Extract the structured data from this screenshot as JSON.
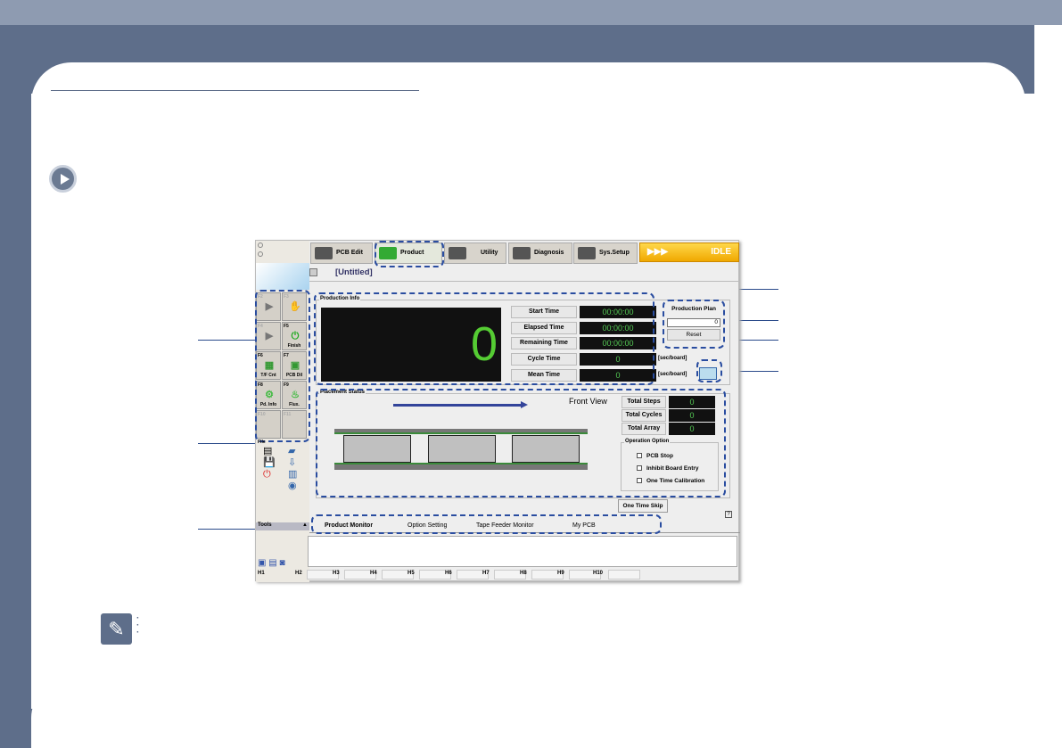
{
  "app": {
    "tabs": [
      {
        "label": "PCB Edit"
      },
      {
        "label": "Product"
      },
      {
        "label": "Utility"
      },
      {
        "label": "Diagnosis"
      },
      {
        "label": "Sys.Setup"
      }
    ],
    "status": {
      "arrows": "▶▶▶",
      "label": "IDLE"
    },
    "file_title": "[Untitled]",
    "sidebar": {
      "fkeys": [
        {
          "key": "F2",
          "label": ""
        },
        {
          "key": "F3",
          "label": ""
        },
        {
          "key": "F4",
          "label": ""
        },
        {
          "key": "F5",
          "label": "Finish"
        },
        {
          "key": "F6",
          "label": "T/F Cnt"
        },
        {
          "key": "F7",
          "label": "PCB Dil"
        },
        {
          "key": "F8",
          "label": "Pd. Info"
        },
        {
          "key": "F9",
          "label": "Flux."
        },
        {
          "key": "F10",
          "label": ""
        },
        {
          "key": "F11",
          "label": ""
        }
      ],
      "file_label": "File",
      "tools_label": "Tools"
    },
    "production_info": {
      "title": "Production Info",
      "big_count": "0",
      "rows": [
        {
          "label": "Start Time",
          "value": "00:00:00"
        },
        {
          "label": "Elapsed Time",
          "value": "00:00:00"
        },
        {
          "label": "Remaining Time",
          "value": "00:00:00"
        },
        {
          "label": "Cycle Time",
          "value": "0"
        },
        {
          "label": "Mean Time",
          "value": "0"
        }
      ],
      "plan_label": "Production Plan",
      "plan_value": "0",
      "reset_label": "Reset",
      "unit1": "[sec/board]",
      "unit2": "[sec/board]"
    },
    "placement": {
      "title": "Placement Status",
      "view": "Front View",
      "stats": [
        {
          "label": "Total Steps",
          "value": "0"
        },
        {
          "label": "Total Cycles",
          "value": "0"
        },
        {
          "label": "Total Array",
          "value": "0"
        }
      ],
      "option_title": "Operation Option",
      "options": [
        {
          "label": "PCB Stop"
        },
        {
          "label": "Inhibit Board Entry"
        },
        {
          "label": "One Time Calibration"
        }
      ]
    },
    "one_time_skip": "One Time Skip",
    "help": "?",
    "bottom_tabs": [
      {
        "label": "Product Monitor"
      },
      {
        "label": "Option Setting"
      },
      {
        "label": "Tape Feeder Monitor"
      },
      {
        "label": "My PCB"
      }
    ],
    "hkeys": [
      "H1",
      "H2",
      "H3",
      "H4",
      "H5",
      "H6",
      "H7",
      "H8",
      "H9",
      "H10"
    ]
  },
  "colors": {
    "accent": "#5e6e8a",
    "dash": "#2a4da0",
    "led": "#55cc55",
    "idle": "#f5b400"
  }
}
